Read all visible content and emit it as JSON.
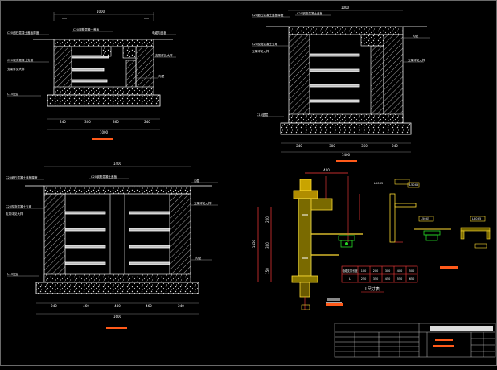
{
  "drawing": {
    "sec_a_title": "",
    "sec_b_title": "",
    "sec_c_title": "",
    "lr_caption": "L尺寸表",
    "labels": {
      "a1": "C20细石混凝土盖板厚度",
      "a2": "C20钢筋混凝土盖板",
      "a3": "C20现浇混凝土支墩",
      "a4": "支架详见大样",
      "a5": "C15垫层",
      "a6": "沟壁",
      "a7": "电缆沟盖板",
      "b1": "C20细石混凝土盖板厚度",
      "b2": "C20钢筋混凝土盖板",
      "b3": "C20现浇混凝土支墩",
      "b4": "支架详见大样",
      "b5": "C15垫层",
      "b6": "沟壁",
      "c1": "C20细石混凝土盖板厚度",
      "c2": "C20钢筋混凝土盖板",
      "c3": "C20现浇混凝土支墩",
      "c4": "支架详见大样",
      "c5": "C15垫层",
      "c6": "沟壁",
      "d1": "L50X5",
      "d2": "L50X5",
      "d3": "L50X5"
    },
    "dims": {
      "a_top": "1000",
      "a_bottom": [
        "240",
        "300",
        "360",
        "240"
      ],
      "a_total": "1000",
      "b_top": "1000",
      "b_bottom": [
        "240",
        "300",
        "360",
        "240"
      ],
      "b_total": "1400",
      "c_top": "1400",
      "c_bottom": [
        "240",
        "460",
        "480",
        "460",
        "240"
      ],
      "c_total": "1600",
      "d_top": "400",
      "d_side": [
        "200",
        "300",
        "150"
      ],
      "d_height": "1450"
    },
    "table": {
      "rows": [
        [
          "电缆支架长度",
          "100",
          "200",
          "300",
          "400",
          "500"
        ],
        [
          "L",
          "250",
          "350",
          "450",
          "550",
          "650"
        ]
      ]
    },
    "title_block": {
      "header": "",
      "note": ""
    }
  }
}
